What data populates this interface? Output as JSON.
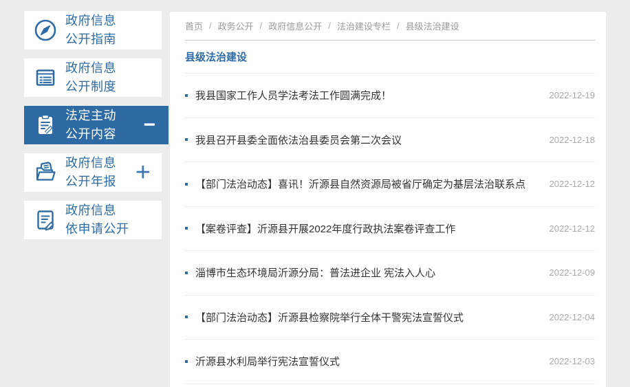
{
  "colors": {
    "accent": "#2e6ba4",
    "page_background": "#ececec",
    "panel_background": "#ffffff",
    "article_text": "#333333",
    "muted_text": "#999999",
    "date_text": "#a9a9a9"
  },
  "sidebar": {
    "items": [
      {
        "line1": "政府信息",
        "line2": "公开指南",
        "icon": "compass-icon",
        "active": false
      },
      {
        "line1": "政府信息",
        "line2": "公开制度",
        "icon": "document-list-icon",
        "active": false
      },
      {
        "line1": "法定主动",
        "line2": "公开内容",
        "icon": "clipboard-pencil-icon",
        "active": true,
        "toggle": "−"
      },
      {
        "line1": "政府信息",
        "line2": "公开年报",
        "icon": "folder-icon",
        "active": false,
        "toggle": "+"
      },
      {
        "line1": "政府信息",
        "line2": "依申请公开",
        "icon": "document-edit-icon",
        "active": false
      }
    ]
  },
  "breadcrumb": {
    "separator": "/",
    "items": [
      "首页",
      "政务公开",
      "政府信息公开",
      "法治建设专栏",
      "县级法治建设"
    ]
  },
  "main": {
    "title": "县级法治建设",
    "articles": [
      {
        "title": "我县国家工作人员学法考法工作圆满完成！",
        "date": "2022-12-19"
      },
      {
        "title": "我县召开县委全面依法治县委员会第二次会议",
        "date": "2022-12-18"
      },
      {
        "title": "【部门法治动态】喜讯！沂源县自然资源局被省厅确定为基层法治联系点",
        "date": "2022-12-12"
      },
      {
        "title": "【案卷评查】沂源县开展2022年度行政执法案卷评查工作",
        "date": "2022-12-12"
      },
      {
        "title": "淄博市生态环境局沂源分局：普法进企业 宪法入人心",
        "date": "2022-12-09"
      },
      {
        "title": "【部门法治动态】沂源县检察院举行全体干警宪法宣誓仪式",
        "date": "2022-12-04"
      },
      {
        "title": "沂源县水利局举行宪法宣誓仪式",
        "date": "2022-12-03"
      }
    ]
  }
}
